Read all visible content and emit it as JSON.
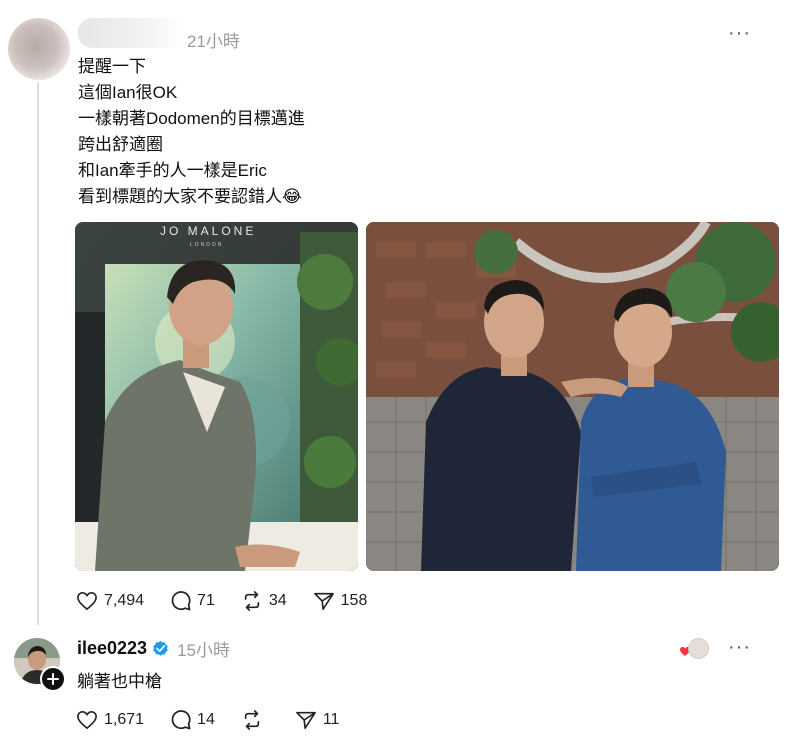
{
  "post": {
    "time": "21小時",
    "more_label": "···",
    "lines": [
      "提醒一下",
      "這個Ian很OK",
      "一樣朝著Dodomen的目標邁進",
      "跨出舒適圈",
      "和Ian牽手的人一樣是Eric",
      "看到標題的大家不要認錯人😂"
    ],
    "photo1": {
      "store_logo": "JO MALONE",
      "store_sub": "LONDON"
    },
    "likes": "7,494",
    "comments": "71",
    "reposts": "34",
    "shares": "158"
  },
  "reply": {
    "username": "ilee0223",
    "time": "15小時",
    "more_label": "···",
    "text": "躺著也中槍",
    "likes": "1,671",
    "comments": "14",
    "reposts": "",
    "shares": "11"
  },
  "colors": {
    "verified": "#1d9bf0",
    "heart_red": "#ff3040",
    "muted": "#9a9a9a"
  },
  "icons": [
    "heart-icon",
    "comment-icon",
    "repost-icon",
    "share-icon",
    "verified-icon",
    "follow-plus-icon",
    "more-icon"
  ]
}
